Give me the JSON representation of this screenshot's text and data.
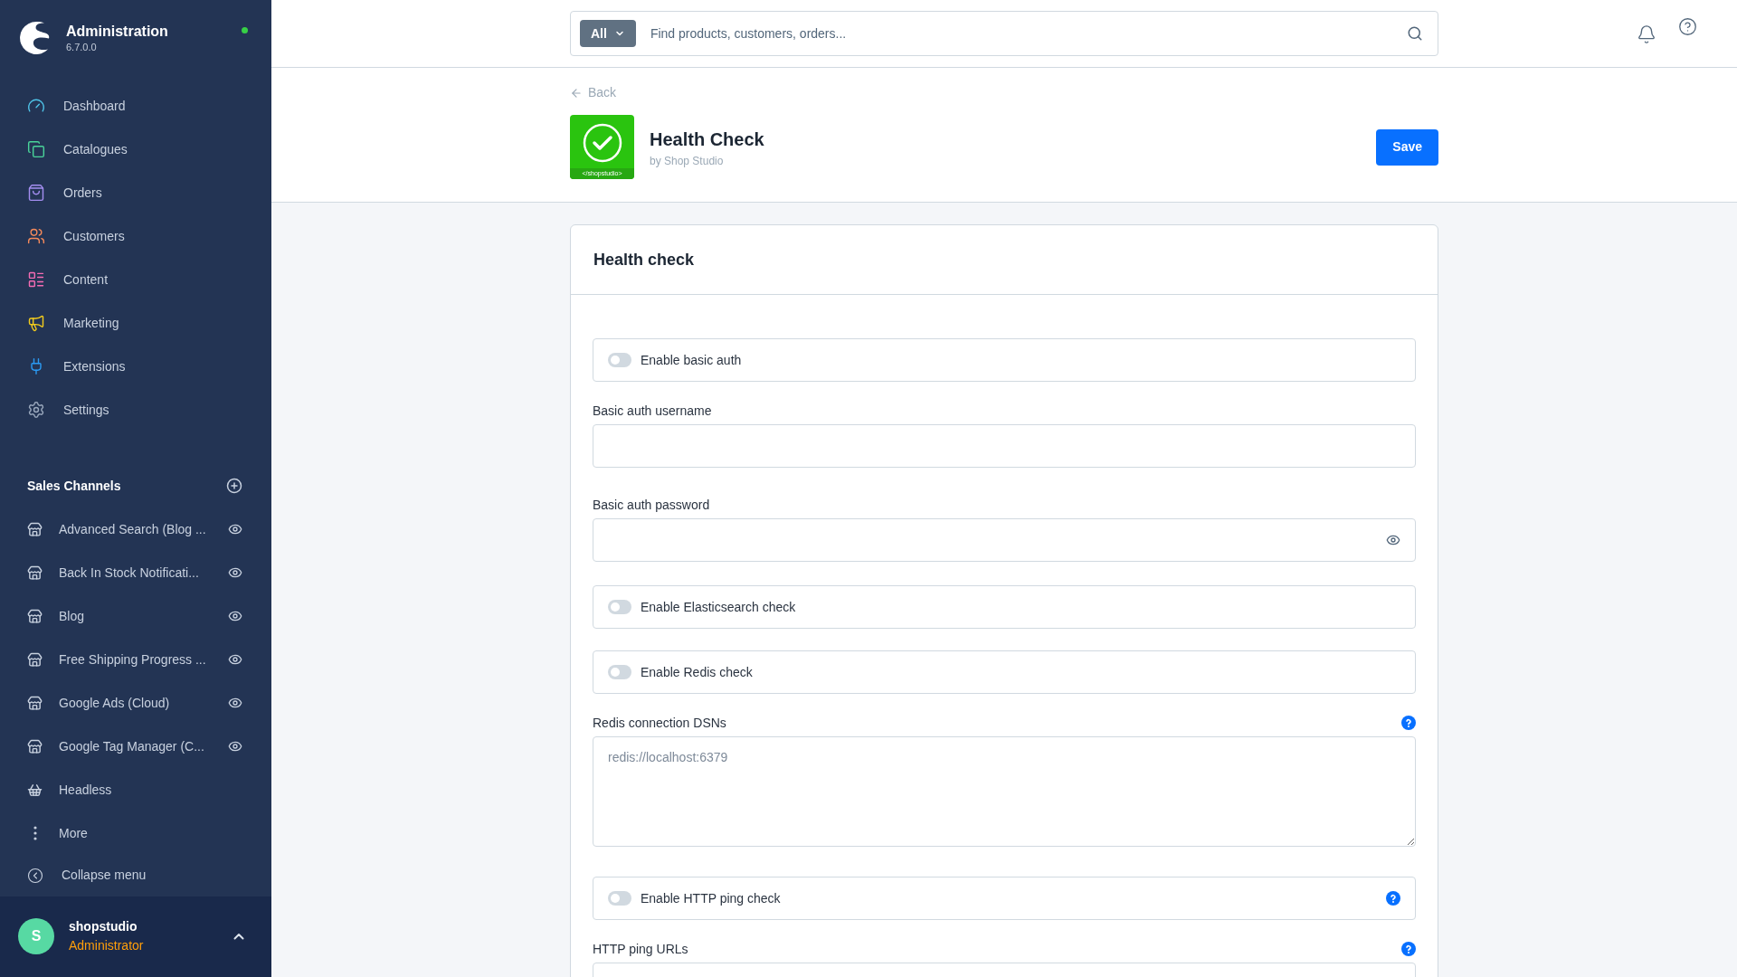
{
  "sidebar": {
    "app_name": "Administration",
    "version": "6.7.0.0",
    "online": true,
    "nav": [
      {
        "label": "Dashboard",
        "color": "#4fc3e8"
      },
      {
        "label": "Catalogues",
        "color": "#4ad49a"
      },
      {
        "label": "Orders",
        "color": "#a48ef0"
      },
      {
        "label": "Customers",
        "color": "#f58a5b"
      },
      {
        "label": "Content",
        "color": "#f56cb4"
      },
      {
        "label": "Marketing",
        "color": "#f5cd1c"
      },
      {
        "label": "Extensions",
        "color": "#2b9af3"
      },
      {
        "label": "Settings",
        "color": "#9aa8bd"
      }
    ],
    "sales_channels": {
      "title": "Sales Channels",
      "items": [
        {
          "label": "Advanced Search (Blog ...",
          "kind": "storefront"
        },
        {
          "label": "Back In Stock Notificati...",
          "kind": "storefront"
        },
        {
          "label": "Blog",
          "kind": "storefront"
        },
        {
          "label": "Free Shipping Progress ...",
          "kind": "storefront"
        },
        {
          "label": "Google Ads (Cloud)",
          "kind": "storefront"
        },
        {
          "label": "Google Tag Manager (C...",
          "kind": "storefront"
        },
        {
          "label": "Headless",
          "kind": "headless"
        }
      ],
      "more": "More"
    },
    "collapse": "Collapse menu",
    "user": {
      "initial": "S",
      "name": "shopstudio",
      "role": "Administrator"
    }
  },
  "search": {
    "scope": "All",
    "placeholder": "Find products, customers, orders..."
  },
  "page": {
    "back": "Back",
    "title": "Health Check",
    "vendor": "by Shop Studio",
    "app_icon_caption": "</shopstudio>",
    "save": "Save"
  },
  "card": {
    "title": "Health check",
    "fields": [
      {
        "kind": "toggle",
        "label": "Enable basic auth",
        "on": false,
        "help": false
      },
      {
        "kind": "text",
        "label": "Basic auth username",
        "help": false
      },
      {
        "kind": "password",
        "label": "Basic auth password",
        "help": false
      },
      {
        "kind": "toggle",
        "label": "Enable Elasticsearch check",
        "on": false,
        "help": false
      },
      {
        "kind": "toggle",
        "label": "Enable Redis check",
        "on": false,
        "help": false
      },
      {
        "kind": "textarea",
        "label": "Redis connection DSNs",
        "placeholder": "redis://localhost:6379",
        "help": true
      },
      {
        "kind": "toggle",
        "label": "Enable HTTP ping check",
        "on": false,
        "help": true
      },
      {
        "kind": "text",
        "label": "HTTP ping URLs",
        "help": true
      }
    ]
  }
}
